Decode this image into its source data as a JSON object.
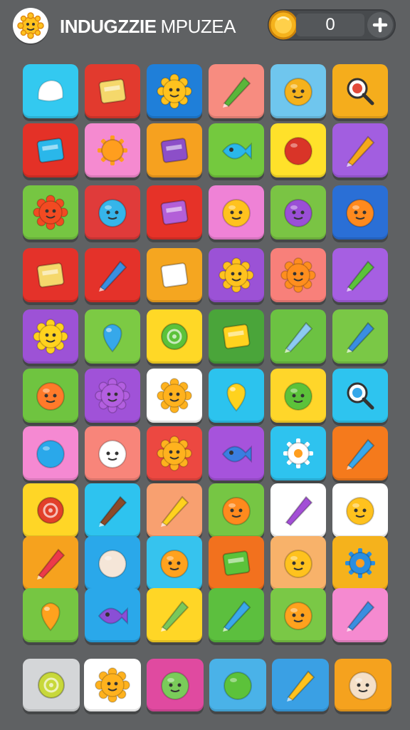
{
  "header": {
    "title_bold": "INDUGZZIE",
    "title_light": "MPUZEA",
    "coin_count": "0",
    "add_label": "+",
    "logo_icon": "sun-creature-icon",
    "coin_icon": "gold-coin-icon"
  },
  "board": {
    "columns": 6,
    "rows": [
      [
        {
          "bg": "#33c9f0",
          "icon": "ghost-blob-icon",
          "color": "#ffffff"
        },
        {
          "bg": "#e23a2e",
          "icon": "flag-card-icon",
          "color": "#f5d86b"
        },
        {
          "bg": "#1f7fd9",
          "icon": "sun-face-icon",
          "color": "#ffc21e"
        },
        {
          "bg": "#f78c80",
          "icon": "crayon-icon",
          "color": "#5ab53a"
        },
        {
          "bg": "#6fc6ee",
          "icon": "robot-face-icon",
          "color": "#f5b21c"
        },
        {
          "bg": "#f5ad1c",
          "icon": "magnifier-icon",
          "color": "#e24a3a"
        }
      ],
      [
        {
          "bg": "#e43127",
          "icon": "tilted-card-icon",
          "color": "#2ab7ea"
        },
        {
          "bg": "#f58ad0",
          "icon": "gear-orb-icon",
          "color": "#ff9e1e"
        },
        {
          "bg": "#f6a11f",
          "icon": "cube-dots-icon",
          "color": "#8c4fc8"
        },
        {
          "bg": "#74c93e",
          "icon": "fish-eye-icon",
          "color": "#2ab7ea"
        },
        {
          "bg": "#ffe12a",
          "icon": "red-blob-icon",
          "color": "#d93428"
        },
        {
          "bg": "#a25ee0",
          "icon": "arrow-shard-icon",
          "color": "#f5a81c"
        }
      ],
      [
        {
          "bg": "#76c642",
          "icon": "red-sun-icon",
          "color": "#f24a22"
        },
        {
          "bg": "#e03b3a",
          "icon": "balloon-icon",
          "color": "#36b5ea"
        },
        {
          "bg": "#e63228",
          "icon": "purple-card-icon",
          "color": "#b35fd8"
        },
        {
          "bg": "#ef82d6",
          "icon": "kitty-face-icon",
          "color": "#ffc21e"
        },
        {
          "bg": "#7ac444",
          "icon": "purple-ball-icon",
          "color": "#9a4fd6"
        },
        {
          "bg": "#2a6fd6",
          "icon": "orange-face-icon",
          "color": "#ff8a1e"
        }
      ],
      [
        {
          "bg": "#e4322a",
          "icon": "flag-card-icon",
          "color": "#f5d86b"
        },
        {
          "bg": "#e4322a",
          "icon": "pencil-icon",
          "color": "#3a8ee0"
        },
        {
          "bg": "#f5a620",
          "icon": "white-cube-icon",
          "color": "#ffffff"
        },
        {
          "bg": "#9b52d6",
          "icon": "sun-face-icon",
          "color": "#ffc21e"
        },
        {
          "bg": "#f8807a",
          "icon": "sun-face-icon",
          "color": "#ff8e1e"
        },
        {
          "bg": "#a65fe2",
          "icon": "green-gem-icon",
          "color": "#5cc23a"
        }
      ],
      [
        {
          "bg": "#9d52d6",
          "icon": "sun-face-icon",
          "color": "#ffd21e"
        },
        {
          "bg": "#7cca44",
          "icon": "blue-pin-icon",
          "color": "#36a8ea"
        },
        {
          "bg": "#ffd826",
          "icon": "green-donut-icon",
          "color": "#5cc23a"
        },
        {
          "bg": "#4aa53a",
          "icon": "yellow-block-icon",
          "color": "#ffd21e"
        },
        {
          "bg": "#6cc242",
          "icon": "rocket-fish-icon",
          "color": "#8ccaf2"
        },
        {
          "bg": "#7ac846",
          "icon": "blue-gem-icon",
          "color": "#3a8ee0"
        }
      ],
      [
        {
          "bg": "#6fc440",
          "icon": "orange-face-icon",
          "color": "#ff7a2a"
        },
        {
          "bg": "#a052d8",
          "icon": "purple-sun-icon",
          "color": "#b35fe0"
        },
        {
          "bg": "#ffffff",
          "icon": "sun-face-icon",
          "color": "#ffb21e"
        },
        {
          "bg": "#2cc3ee",
          "icon": "lemon-icon",
          "color": "#ffd21e"
        },
        {
          "bg": "#ffd62a",
          "icon": "green-frog-icon",
          "color": "#5cc23a"
        },
        {
          "bg": "#2ec4ef",
          "icon": "magnifier-icon",
          "color": "#36a8ea"
        }
      ],
      [
        {
          "bg": "#f589d2",
          "icon": "blue-blob-icon",
          "color": "#2aa8ea"
        },
        {
          "bg": "#f8857a",
          "icon": "white-cloud-icon",
          "color": "#ffffff"
        },
        {
          "bg": "#ec4841",
          "icon": "sun-face-icon",
          "color": "#ffb21e"
        },
        {
          "bg": "#a653dc",
          "icon": "fish-eye-icon",
          "color": "#3a7ee0"
        },
        {
          "bg": "#2ec3ef",
          "icon": "white-gear-icon",
          "color": "#ffffff"
        },
        {
          "bg": "#f57a1c",
          "icon": "planet-icon",
          "color": "#3aa8ea"
        }
      ],
      [
        {
          "bg": "#ffd626",
          "icon": "spiral-icon",
          "color": "#e2402a"
        },
        {
          "bg": "#2ec3ef",
          "icon": "brown-shoe-icon",
          "color": "#8a4a2a"
        },
        {
          "bg": "#f8a070",
          "icon": "paper-plane-icon",
          "color": "#ffd21e"
        },
        {
          "bg": "#76c644",
          "icon": "orange-ball-icon",
          "color": "#ff8a1e"
        },
        {
          "bg": "#ffffff",
          "icon": "purple-kite-icon",
          "color": "#a34fd6"
        },
        {
          "bg": "#ffffff",
          "icon": "grin-face-icon",
          "color": "#ffc21e"
        }
      ],
      [
        {
          "bg": "#f6a21e",
          "icon": "pencil-icon",
          "color": "#ec3a4a"
        },
        {
          "bg": "#2aa8ea",
          "icon": "white-blob-icon",
          "color": "#f5e6d8"
        },
        {
          "bg": "#36c3ee",
          "icon": "orange-ball-icon",
          "color": "#ffa21e"
        },
        {
          "bg": "#f2711e",
          "icon": "house-icon",
          "color": "#5cc23a"
        },
        {
          "bg": "#f8b26a",
          "icon": "mouse-face-icon",
          "color": "#ffc21e"
        },
        {
          "bg": "#f5b21c",
          "icon": "blue-gear-icon",
          "color": "#2a8ee0"
        }
      ],
      [
        {
          "bg": "#76c642",
          "icon": "orange-drop-icon",
          "color": "#ffa21e"
        },
        {
          "bg": "#2aa8ea",
          "icon": "purple-fish-icon",
          "color": "#8a4fd6"
        },
        {
          "bg": "#ffd626",
          "icon": "green-rocket-icon",
          "color": "#7ac85a"
        },
        {
          "bg": "#5cbf3e",
          "icon": "paper-plane-icon",
          "color": "#3aa8ea"
        },
        {
          "bg": "#7ac846",
          "icon": "orange-face-icon",
          "color": "#ffa21e"
        },
        {
          "bg": "#f58ad0",
          "icon": "blue-plane-icon",
          "color": "#3a8ee0"
        }
      ]
    ]
  },
  "tray": [
    {
      "bg": "#d4d6d8",
      "icon": "lime-donut-icon",
      "color": "#c8d83a"
    },
    {
      "bg": "#ffffff",
      "icon": "sun-face-icon",
      "color": "#ffb21e"
    },
    {
      "bg": "#e04aa0",
      "icon": "green-alien-icon",
      "color": "#7acb5a"
    },
    {
      "bg": "#4ab2e8",
      "icon": "green-blob-icon",
      "color": "#5cc23a"
    },
    {
      "bg": "#3aa0e4",
      "icon": "yellow-arrow-icon",
      "color": "#ffc21e"
    },
    {
      "bg": "#f5a21e",
      "icon": "cream-face-icon",
      "color": "#f5e0c8"
    }
  ],
  "colors": {
    "background": "#5f6163",
    "counter_bg": "#474a4d",
    "coin": "#f5b21c"
  }
}
